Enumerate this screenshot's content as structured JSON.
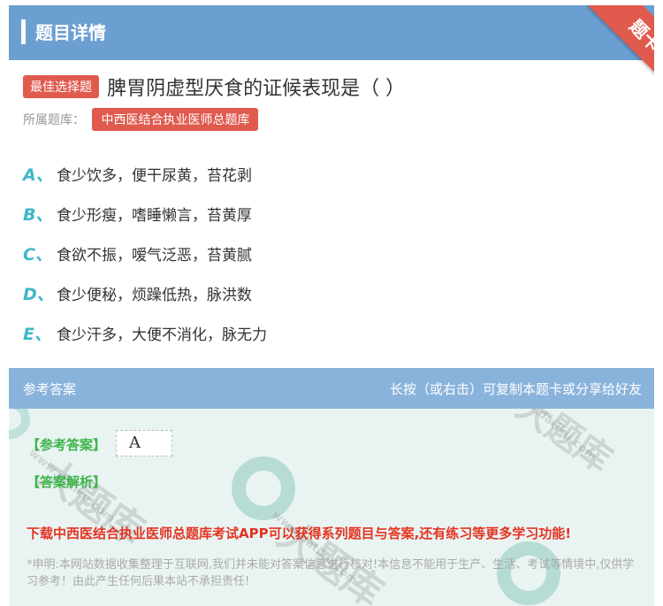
{
  "header": {
    "title": "题目详情",
    "ribbon": "题卡"
  },
  "question": {
    "tag": "最佳选择题",
    "text": "脾胃阴虚型厌食的证候表现是（ ）",
    "library_label": "所属题库：",
    "library_name": "中西医结合执业医师总题库"
  },
  "options": [
    {
      "letter": "A、",
      "text": "食少饮多，便干尿黄，苔花剥"
    },
    {
      "letter": "B、",
      "text": "食少形瘦，嗜睡懒言，苔黄厚"
    },
    {
      "letter": "C、",
      "text": "食欲不振，嗳气泛恶，苔黄腻"
    },
    {
      "letter": "D、",
      "text": "食少便秘，烦躁低热，脉洪数"
    },
    {
      "letter": "E、",
      "text": "食少汗多，大便不消化，脉无力"
    }
  ],
  "answer": {
    "section_title": "参考答案",
    "copy_hint": "长按（或右击）可复制本题卡或分享给好友",
    "answer_label": "【参考答案】",
    "answer_value": "A",
    "analysis_label": "【答案解析】",
    "download_text": "下载中西医结合执业医师总题库考试APP可以获得系列题目与答案,还有练习等更多学习功能!",
    "disclaimer": "*申明:本网站数据收集整理于互联网,我们并未能对答案信息进行核对!本信息不能用于生产、生活、考试等情境中,仅供学习参考！由此产生任何后果本站不承担责任!"
  },
  "watermark": {
    "text": "大题库",
    "url": "www.datiku.com"
  },
  "colors": {
    "header": "#6b9fd2",
    "answer_header": "#8ab3dc",
    "tag_red": "#e05a4e",
    "option_letter": "#3fb7c8",
    "green": "#3cb54a",
    "download_red": "#e53322"
  }
}
